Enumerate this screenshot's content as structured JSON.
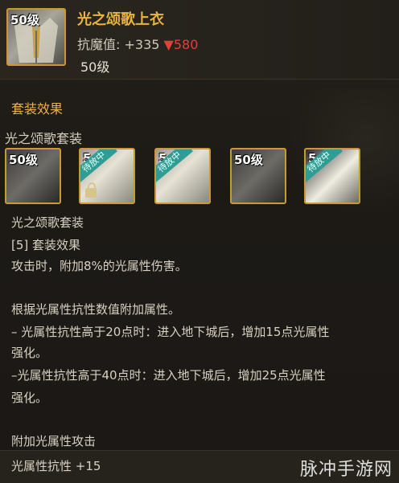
{
  "item": {
    "icon_level": "50级",
    "name": "光之颂歌上衣",
    "stat_label": "抗魔值: +335",
    "stat_change": "▼580",
    "level": "50级"
  },
  "set": {
    "title": "套装效果",
    "name": "光之颂歌套装",
    "slots": [
      {
        "level": "50级",
        "ribbon": "",
        "locked": false,
        "icon": "dark-coat-icon"
      },
      {
        "level": "5",
        "ribbon": "待放中",
        "locked": true,
        "icon": "light-pants-icon"
      },
      {
        "level": "5",
        "ribbon": "待放中",
        "locked": false,
        "icon": "light-coat-icon"
      },
      {
        "level": "50级",
        "ribbon": "",
        "locked": false,
        "icon": "dark-belt-icon"
      },
      {
        "level": "5",
        "ribbon": "待放中",
        "locked": false,
        "icon": "shoe-icon"
      }
    ],
    "desc": {
      "set_name": "光之颂歌套装",
      "bonus_header": "[5] 套装效果",
      "line1": "攻击时，附加8%的光属性伤害。",
      "line2": "根据光属性抗性数值附加属性。",
      "line3": "– 光属性抗性高于20点时：进入地下城后，增加15点光属性",
      "line3b": "强化。",
      "line4": "–光属性抗性高于40点时：进入地下城后，增加25点光属性",
      "line4b": "强化。",
      "line5": "附加光属性攻击"
    }
  },
  "footer": {
    "stat": "光属性抗性 +15",
    "watermark": "脉冲手游网"
  },
  "colors": {
    "gold": "#e8b53e",
    "down_red": "#e0413a",
    "ribbon_teal": "#2f9d93"
  }
}
